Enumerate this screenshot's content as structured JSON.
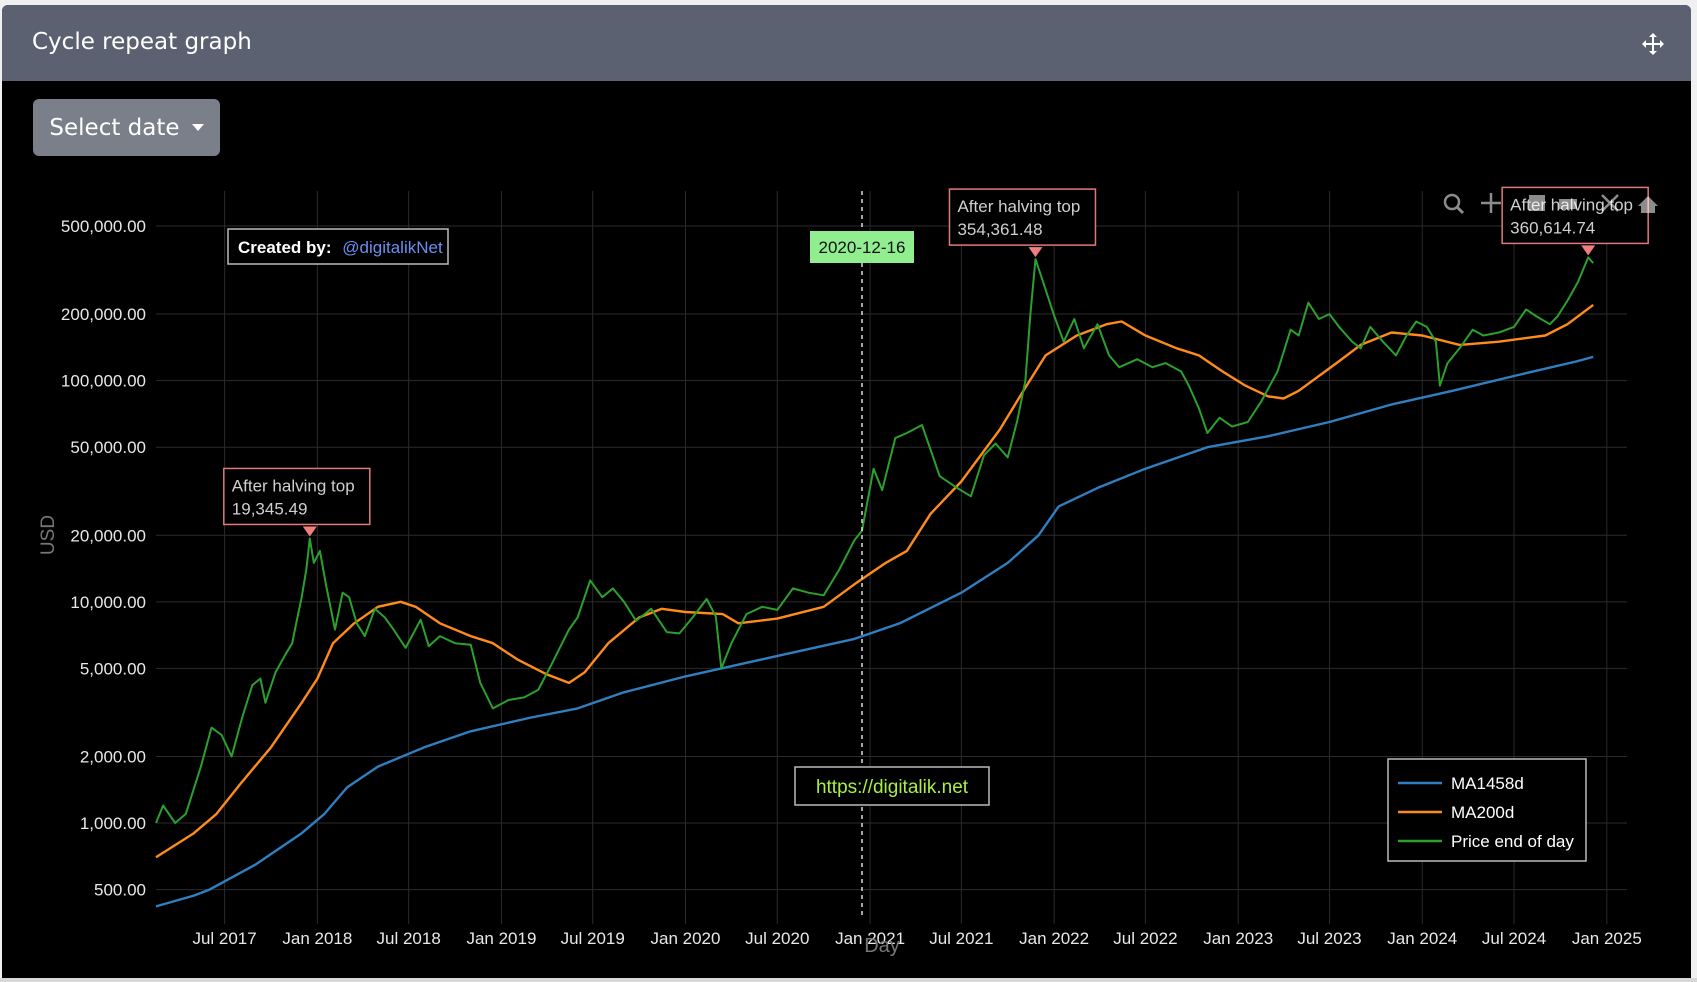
{
  "header": {
    "title": "Cycle repeat graph"
  },
  "controls": {
    "select_date_label": "Select date"
  },
  "toolbar": {
    "icons": [
      "zoom-icon",
      "pan-icon",
      "zoom-in-icon",
      "zoom-out-icon",
      "autoscale-icon",
      "reset-axes-icon"
    ]
  },
  "colors": {
    "ma1458": "#2f7fc1",
    "ma200": "#ff8c1a",
    "price": "#2ca02c",
    "annotation_border": "#e07a7a",
    "date_label_bg": "#90ee90",
    "link": "#aaee44",
    "credit_link": "#6b8ff0"
  },
  "chart_data": {
    "type": "line",
    "xlabel": "Day",
    "ylabel": "USD",
    "yscale": "log",
    "ylim": [
      380,
      720000
    ],
    "xlim": [
      "2017-02-15",
      "2025-02-10"
    ],
    "x_ticks": [
      "2017-07-01",
      "2018-01-01",
      "2018-07-01",
      "2019-01-01",
      "2019-07-01",
      "2020-01-01",
      "2020-07-01",
      "2021-01-01",
      "2021-07-01",
      "2022-01-01",
      "2022-07-01",
      "2023-01-01",
      "2023-07-01",
      "2024-01-01",
      "2024-07-01",
      "2025-01-01"
    ],
    "x_tick_labels": [
      "Jul 2017",
      "Jan 2018",
      "Jul 2018",
      "Jan 2019",
      "Jul 2019",
      "Jan 2020",
      "Jul 2020",
      "Jan 2021",
      "Jul 2021",
      "Jan 2022",
      "Jul 2022",
      "Jan 2023",
      "Jul 2023",
      "Jan 2024",
      "Jul 2024",
      "Jan 2025"
    ],
    "y_ticks": [
      500,
      1000,
      2000,
      5000,
      10000,
      20000,
      50000,
      100000,
      200000,
      500000
    ],
    "y_tick_labels": [
      "500.00",
      "1,000.00",
      "2,000.00",
      "5,000.00",
      "10,000.00",
      "20,000.00",
      "50,000.00",
      "100,000.00",
      "200,000.00",
      "500,000.00"
    ],
    "grid": true,
    "legend_position": "bottom-right",
    "series": [
      {
        "name": "MA1458d",
        "color": "#2f7fc1",
        "points": [
          [
            "2017-02-15",
            420
          ],
          [
            "2017-05-01",
            470
          ],
          [
            "2017-06-01",
            500
          ],
          [
            "2017-09-01",
            650
          ],
          [
            "2017-12-01",
            900
          ],
          [
            "2018-01-15",
            1100
          ],
          [
            "2018-03-01",
            1450
          ],
          [
            "2018-05-01",
            1800
          ],
          [
            "2018-08-01",
            2200
          ],
          [
            "2018-11-01",
            2600
          ],
          [
            "2019-03-01",
            3000
          ],
          [
            "2019-06-01",
            3300
          ],
          [
            "2019-09-01",
            3900
          ],
          [
            "2020-01-01",
            4600
          ],
          [
            "2020-06-01",
            5500
          ],
          [
            "2020-12-01",
            6800
          ],
          [
            "2021-03-01",
            8000
          ],
          [
            "2021-07-01",
            11000
          ],
          [
            "2021-10-01",
            15000
          ],
          [
            "2021-12-01",
            20000
          ],
          [
            "2022-01-10",
            27000
          ],
          [
            "2022-04-01",
            33000
          ],
          [
            "2022-07-01",
            40000
          ],
          [
            "2022-11-01",
            50000
          ],
          [
            "2023-03-01",
            56000
          ],
          [
            "2023-07-01",
            65000
          ],
          [
            "2023-11-01",
            78000
          ],
          [
            "2024-03-01",
            90000
          ],
          [
            "2024-07-01",
            105000
          ],
          [
            "2024-11-01",
            122000
          ],
          [
            "2024-12-05",
            128000
          ]
        ]
      },
      {
        "name": "MA200d",
        "color": "#ff8c1a",
        "points": [
          [
            "2017-02-15",
            700
          ],
          [
            "2017-05-01",
            900
          ],
          [
            "2017-06-15",
            1100
          ],
          [
            "2017-08-01",
            1500
          ],
          [
            "2017-10-01",
            2200
          ],
          [
            "2017-12-01",
            3500
          ],
          [
            "2018-01-01",
            4500
          ],
          [
            "2018-02-01",
            6500
          ],
          [
            "2018-03-15",
            8000
          ],
          [
            "2018-05-01",
            9500
          ],
          [
            "2018-06-15",
            10000
          ],
          [
            "2018-07-15",
            9500
          ],
          [
            "2018-09-01",
            8000
          ],
          [
            "2018-11-01",
            7000
          ],
          [
            "2018-12-15",
            6500
          ],
          [
            "2019-02-01",
            5500
          ],
          [
            "2019-04-01",
            4700
          ],
          [
            "2019-05-15",
            4300
          ],
          [
            "2019-06-15",
            4800
          ],
          [
            "2019-08-01",
            6500
          ],
          [
            "2019-10-01",
            8500
          ],
          [
            "2019-11-15",
            9300
          ],
          [
            "2020-01-01",
            9000
          ],
          [
            "2020-03-15",
            8800
          ],
          [
            "2020-04-15",
            8000
          ],
          [
            "2020-07-01",
            8400
          ],
          [
            "2020-10-01",
            9500
          ],
          [
            "2020-12-01",
            12000
          ],
          [
            "2021-02-01",
            15000
          ],
          [
            "2021-03-15",
            17000
          ],
          [
            "2021-05-01",
            25000
          ],
          [
            "2021-07-01",
            35000
          ],
          [
            "2021-09-15",
            60000
          ],
          [
            "2021-11-01",
            90000
          ],
          [
            "2021-12-15",
            130000
          ],
          [
            "2022-02-15",
            160000
          ],
          [
            "2022-04-15",
            180000
          ],
          [
            "2022-05-15",
            185000
          ],
          [
            "2022-07-01",
            160000
          ],
          [
            "2022-09-01",
            140000
          ],
          [
            "2022-10-15",
            130000
          ],
          [
            "2022-12-01",
            110000
          ],
          [
            "2023-01-15",
            95000
          ],
          [
            "2023-03-01",
            85000
          ],
          [
            "2023-04-01",
            83000
          ],
          [
            "2023-05-01",
            90000
          ],
          [
            "2023-07-15",
            120000
          ],
          [
            "2023-09-01",
            145000
          ],
          [
            "2023-11-01",
            165000
          ],
          [
            "2024-01-01",
            160000
          ],
          [
            "2024-03-15",
            145000
          ],
          [
            "2024-06-01",
            150000
          ],
          [
            "2024-09-01",
            160000
          ],
          [
            "2024-10-15",
            180000
          ],
          [
            "2024-12-05",
            220000
          ]
        ]
      },
      {
        "name": "Price end of day",
        "color": "#2ca02c",
        "points": [
          [
            "2017-02-15",
            1000
          ],
          [
            "2017-03-01",
            1200
          ],
          [
            "2017-03-25",
            1000
          ],
          [
            "2017-04-15",
            1100
          ],
          [
            "2017-05-15",
            1800
          ],
          [
            "2017-06-05",
            2700
          ],
          [
            "2017-06-25",
            2500
          ],
          [
            "2017-07-15",
            2000
          ],
          [
            "2017-08-05",
            3000
          ],
          [
            "2017-08-25",
            4200
          ],
          [
            "2017-09-10",
            4500
          ],
          [
            "2017-09-20",
            3500
          ],
          [
            "2017-10-10",
            4800
          ],
          [
            "2017-10-30",
            5800
          ],
          [
            "2017-11-12",
            6500
          ],
          [
            "2017-11-20",
            8000
          ],
          [
            "2017-12-01",
            10500
          ],
          [
            "2017-12-10",
            14000
          ],
          [
            "2017-12-17",
            19345
          ],
          [
            "2017-12-25",
            15000
          ],
          [
            "2018-01-06",
            17000
          ],
          [
            "2018-01-18",
            12000
          ],
          [
            "2018-02-05",
            7500
          ],
          [
            "2018-02-20",
            11000
          ],
          [
            "2018-03-05",
            10500
          ],
          [
            "2018-03-20",
            8000
          ],
          [
            "2018-04-05",
            7000
          ],
          [
            "2018-04-25",
            9300
          ],
          [
            "2018-05-15",
            8500
          ],
          [
            "2018-06-01",
            7500
          ],
          [
            "2018-06-25",
            6200
          ],
          [
            "2018-07-25",
            8300
          ],
          [
            "2018-08-10",
            6300
          ],
          [
            "2018-09-01",
            7000
          ],
          [
            "2018-10-01",
            6500
          ],
          [
            "2018-11-01",
            6400
          ],
          [
            "2018-11-20",
            4300
          ],
          [
            "2018-12-15",
            3300
          ],
          [
            "2019-01-15",
            3600
          ],
          [
            "2019-02-15",
            3700
          ],
          [
            "2019-03-15",
            4000
          ],
          [
            "2019-04-10",
            5200
          ],
          [
            "2019-05-15",
            7500
          ],
          [
            "2019-06-01",
            8500
          ],
          [
            "2019-06-26",
            12500
          ],
          [
            "2019-07-20",
            10500
          ],
          [
            "2019-08-10",
            11500
          ],
          [
            "2019-09-01",
            10000
          ],
          [
            "2019-09-25",
            8200
          ],
          [
            "2019-10-25",
            9300
          ],
          [
            "2019-11-25",
            7300
          ],
          [
            "2019-12-20",
            7200
          ],
          [
            "2020-01-15",
            8500
          ],
          [
            "2020-02-12",
            10300
          ],
          [
            "2020-03-01",
            8600
          ],
          [
            "2020-03-12",
            5000
          ],
          [
            "2020-04-01",
            6500
          ],
          [
            "2020-05-01",
            8800
          ],
          [
            "2020-06-01",
            9500
          ],
          [
            "2020-07-01",
            9200
          ],
          [
            "2020-08-01",
            11500
          ],
          [
            "2020-09-01",
            11000
          ],
          [
            "2020-10-01",
            10700
          ],
          [
            "2020-11-01",
            14000
          ],
          [
            "2020-12-01",
            19000
          ],
          [
            "2020-12-16",
            21000
          ],
          [
            "2021-01-08",
            40000
          ],
          [
            "2021-01-25",
            32000
          ],
          [
            "2021-02-20",
            55000
          ],
          [
            "2021-03-15",
            58000
          ],
          [
            "2021-04-14",
            63000
          ],
          [
            "2021-05-19",
            37000
          ],
          [
            "2021-06-20",
            33000
          ],
          [
            "2021-07-20",
            30000
          ],
          [
            "2021-08-15",
            46000
          ],
          [
            "2021-09-07",
            52000
          ],
          [
            "2021-10-01",
            45000
          ],
          [
            "2021-10-20",
            66000
          ],
          [
            "2021-11-05",
            100000
          ],
          [
            "2021-11-15",
            200000
          ],
          [
            "2021-11-25",
            354361
          ],
          [
            "2021-12-10",
            280000
          ],
          [
            "2021-12-31",
            200000
          ],
          [
            "2022-01-20",
            150000
          ],
          [
            "2022-02-10",
            190000
          ],
          [
            "2022-03-01",
            140000
          ],
          [
            "2022-03-28",
            180000
          ],
          [
            "2022-04-20",
            130000
          ],
          [
            "2022-05-10",
            115000
          ],
          [
            "2022-06-15",
            125000
          ],
          [
            "2022-07-15",
            115000
          ],
          [
            "2022-08-10",
            120000
          ],
          [
            "2022-09-10",
            110000
          ],
          [
            "2022-09-25",
            95000
          ],
          [
            "2022-10-15",
            75000
          ],
          [
            "2022-11-01",
            58000
          ],
          [
            "2022-11-25",
            68000
          ],
          [
            "2022-12-20",
            62000
          ],
          [
            "2023-01-20",
            65000
          ],
          [
            "2023-02-15",
            80000
          ],
          [
            "2023-03-20",
            110000
          ],
          [
            "2023-04-15",
            170000
          ],
          [
            "2023-05-01",
            160000
          ],
          [
            "2023-05-20",
            225000
          ],
          [
            "2023-06-10",
            190000
          ],
          [
            "2023-07-01",
            200000
          ],
          [
            "2023-07-20",
            175000
          ],
          [
            "2023-08-15",
            150000
          ],
          [
            "2023-09-01",
            140000
          ],
          [
            "2023-09-20",
            175000
          ],
          [
            "2023-10-15",
            150000
          ],
          [
            "2023-11-10",
            130000
          ],
          [
            "2023-12-01",
            160000
          ],
          [
            "2023-12-20",
            185000
          ],
          [
            "2024-01-10",
            175000
          ],
          [
            "2024-01-28",
            150000
          ],
          [
            "2024-02-05",
            95000
          ],
          [
            "2024-02-20",
            120000
          ],
          [
            "2024-03-15",
            140000
          ],
          [
            "2024-04-10",
            170000
          ],
          [
            "2024-05-01",
            160000
          ],
          [
            "2024-06-01",
            165000
          ],
          [
            "2024-07-01",
            175000
          ],
          [
            "2024-07-25",
            210000
          ],
          [
            "2024-08-15",
            195000
          ],
          [
            "2024-09-10",
            180000
          ],
          [
            "2024-09-25",
            195000
          ],
          [
            "2024-10-15",
            230000
          ],
          [
            "2024-11-05",
            280000
          ],
          [
            "2024-11-25",
            360614
          ],
          [
            "2024-12-05",
            340000
          ]
        ]
      }
    ],
    "annotations": [
      {
        "id": "cycle-2017",
        "x": "2017-12-17",
        "y": 19345.49,
        "line1": "After halving top",
        "line2": "19,345.49"
      },
      {
        "id": "cycle-2021",
        "x": "2021-11-25",
        "y": 354361.48,
        "line1": "After halving top",
        "line2": "354,361.48"
      },
      {
        "id": "cycle-2024",
        "x": "2024-11-25",
        "y": 360614.74,
        "line1": "After halving top",
        "line2": "360,614.74"
      }
    ],
    "vertical_marker": {
      "x": "2020-12-16",
      "label": "2020-12-16"
    },
    "credit": {
      "prefix": "Created by:",
      "handle": "@digitalikNet"
    },
    "watermark": "https://digitalik.net"
  }
}
